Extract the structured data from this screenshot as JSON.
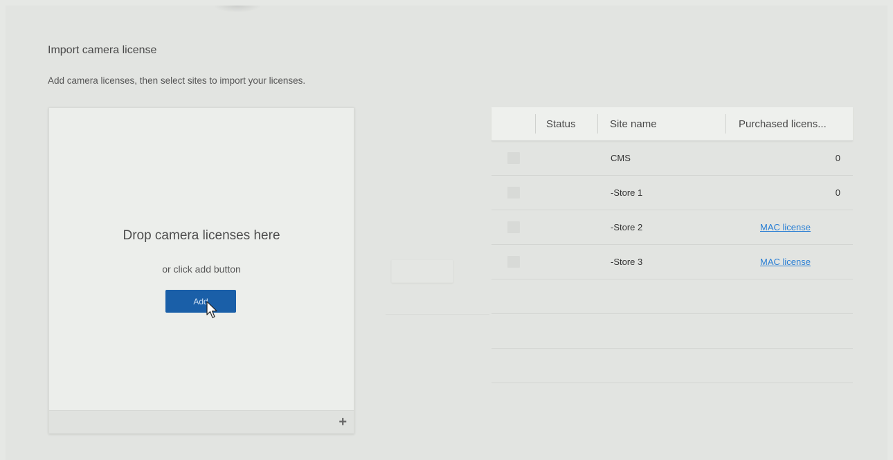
{
  "page": {
    "title": "Import camera license",
    "subtitle": "Add camera licenses, then select sites to import your licenses."
  },
  "drop_panel": {
    "heading": "Drop camera licenses here",
    "subheading": "or click add button",
    "add_button_label": "Add",
    "footer_add_icon": "+"
  },
  "table": {
    "columns": [
      "",
      "Status",
      "Site name",
      "Purchased licens..."
    ],
    "rows": [
      {
        "site_name": "CMS",
        "purchased": "0",
        "purchased_is_link": false
      },
      {
        "site_name": "-Store 1",
        "purchased": "0",
        "purchased_is_link": false
      },
      {
        "site_name": "-Store 2",
        "purchased": "MAC license",
        "purchased_is_link": true
      },
      {
        "site_name": "-Store 3",
        "purchased": "MAC license",
        "purchased_is_link": true
      }
    ]
  },
  "colors": {
    "accent": "#1a5fa8",
    "link": "#2a7fd4",
    "background": "#e2e4e1"
  },
  "icons": {
    "footer_add": "plus-icon",
    "pointer": "mouse-cursor-icon"
  }
}
